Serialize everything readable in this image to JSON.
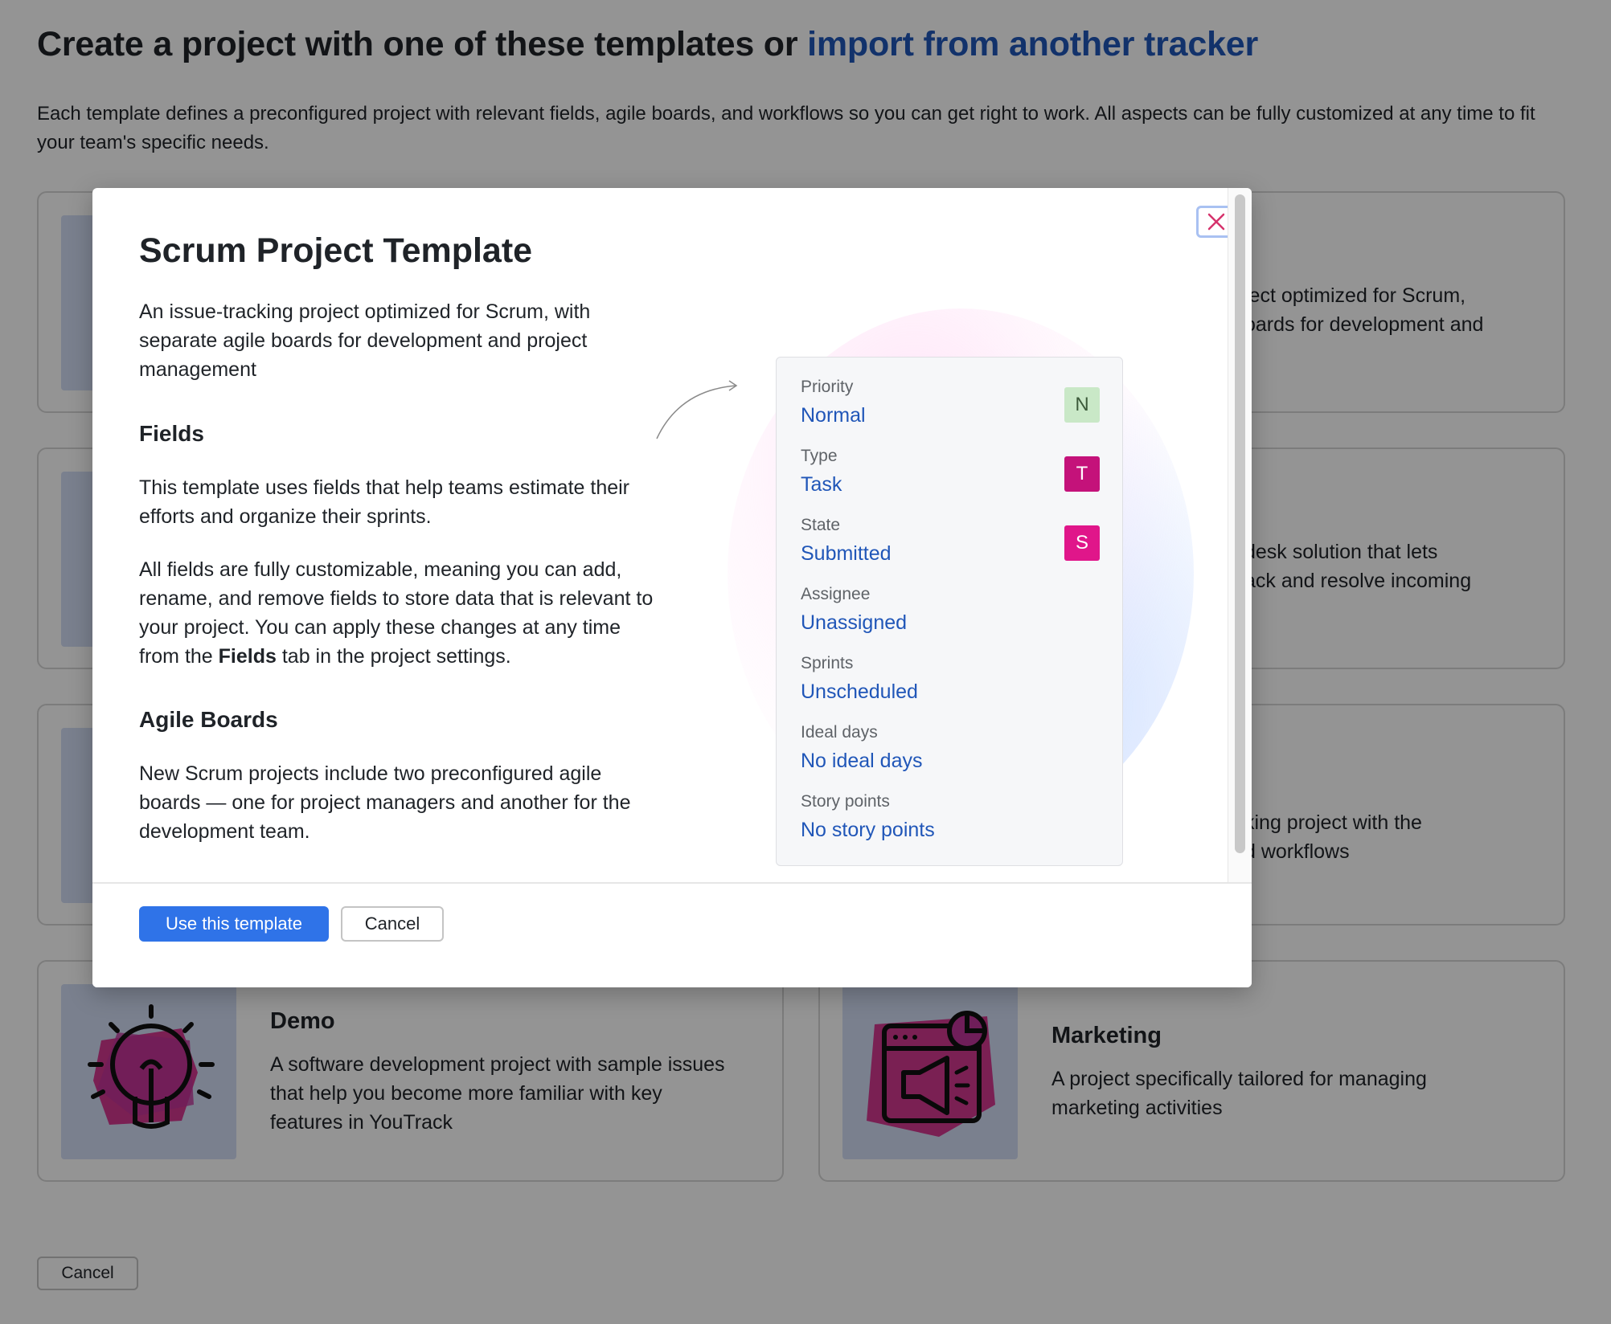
{
  "page": {
    "title_prefix": "Create a project with one of these templates or ",
    "title_link": "import from another tracker",
    "intro": "Each template defines a preconfigured project with relevant fields, agile boards, and workflows so you can get right to work. All aspects can be fully customized at any time to fit your team's specific needs.",
    "cards": [
      {
        "title": "Demo",
        "description": "A software development project with sample issues that help you become more familiar with key features in YouTrack",
        "icon": "lightbulb-icon"
      },
      {
        "title": "Marketing",
        "description": "A project specifically tailored for managing marketing activities",
        "icon": "megaphone-icon"
      }
    ],
    "partial_cards": [
      {
        "line1": "ject optimized for Scrum,",
        "line2": "oards for development and"
      },
      {
        "line1": "desk solution that lets",
        "line2": "ack and resolve incoming"
      },
      {
        "line1": "king project with the",
        "line2": "d workflows"
      }
    ],
    "cancel_label": "Cancel"
  },
  "modal": {
    "title": "Scrum Project Template",
    "description": "An issue-tracking project optimized for Scrum, with separate agile boards for development and project management",
    "fields_heading": "Fields",
    "fields_text1": "This template uses fields that help teams estimate their efforts and organize their sprints.",
    "fields_text2_before": "All fields are fully customizable, meaning you can add, rename, and remove fields to store data that is relevant to your project. You can apply these changes at any time from the ",
    "fields_text2_bold": "Fields",
    "fields_text2_after": " tab in the project settings.",
    "boards_heading": "Agile Boards",
    "boards_text": "New Scrum projects include two preconfigured agile boards — one for project managers and another for the development team.",
    "fields": [
      {
        "label": "Priority",
        "value": "Normal",
        "badge": "N",
        "badge_bg": "#c9e8c7",
        "badge_fg": "#3c5a3a"
      },
      {
        "label": "Type",
        "value": "Task",
        "badge": "T",
        "badge_bg": "#c4127a",
        "badge_fg": "#ffffff"
      },
      {
        "label": "State",
        "value": "Submitted",
        "badge": "S",
        "badge_bg": "#e0168a",
        "badge_fg": "#ffffff"
      },
      {
        "label": "Assignee",
        "value": "Unassigned"
      },
      {
        "label": "Sprints",
        "value": "Unscheduled"
      },
      {
        "label": "Ideal days",
        "value": "No ideal days"
      },
      {
        "label": "Story points",
        "value": "No story points"
      }
    ],
    "primary_label": "Use this template",
    "cancel_label": "Cancel"
  },
  "colors": {
    "link": "#2056b8",
    "primary_button": "#2f73e8",
    "close_icon": "#d6336c"
  }
}
